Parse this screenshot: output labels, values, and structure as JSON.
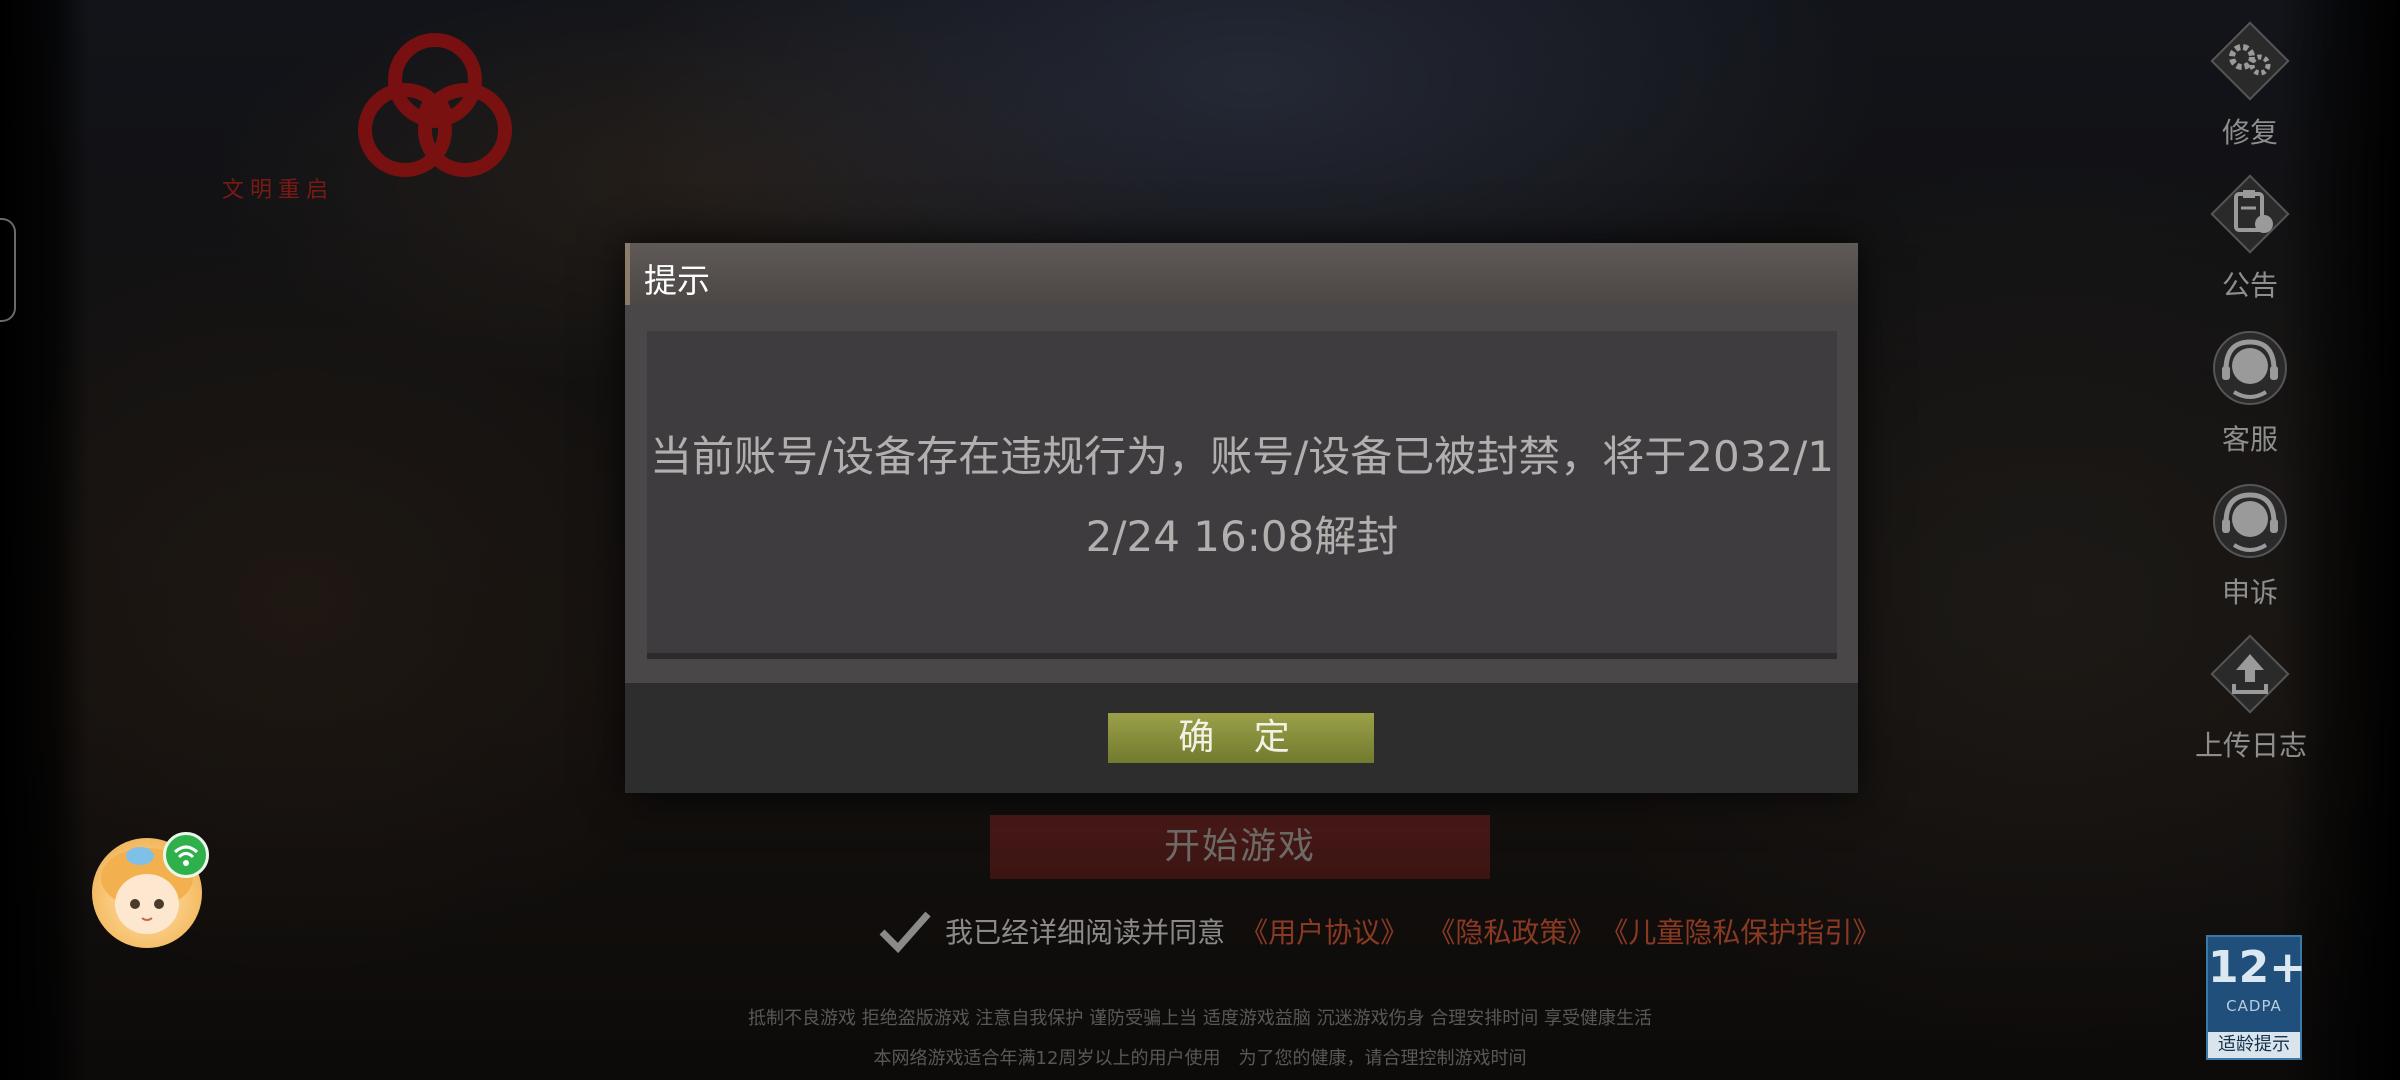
{
  "logo": {
    "subtitle": "文明重启"
  },
  "side_menu": [
    {
      "id": "repair",
      "label": "修复",
      "icon": "gear-icon"
    },
    {
      "id": "announcement",
      "label": "公告",
      "icon": "clipboard-icon"
    },
    {
      "id": "customer_service",
      "label": "客服",
      "icon": "headset-icon"
    },
    {
      "id": "complaint",
      "label": "申诉",
      "icon": "headset-icon"
    },
    {
      "id": "upload_log",
      "label": "上传日志",
      "icon": "upload-icon"
    }
  ],
  "dialog": {
    "title": "提示",
    "message": "当前账号/设备存在违规行为，账号/设备已被封禁，将于2032/12/24 16:08解封",
    "confirm_label": "确 定"
  },
  "start_button_label": "开始游戏",
  "agreement": {
    "text": "我已经详细阅读并同意",
    "links": [
      "《用户协议》",
      "《隐私政策》",
      "《儿童隐私保护指引》"
    ]
  },
  "health_notice": {
    "line1": "抵制不良游戏 拒绝盗版游戏 注意自我保护 谨防受骗上当 适度游戏益脑 沉迷游戏伤身 合理安排时间 享受健康生活",
    "line2": "本网络游戏适合年满12周岁以上的用户使用　为了您的健康，请合理控制游戏时间"
  },
  "age_badge": {
    "rating": "12+",
    "org": "CADPA",
    "label": "适龄提示"
  },
  "colors": {
    "dialog_bg": "#3b393a",
    "confirm_button": "#8a9040",
    "link": "#8a3a22",
    "start_button": "#4a1a18"
  }
}
